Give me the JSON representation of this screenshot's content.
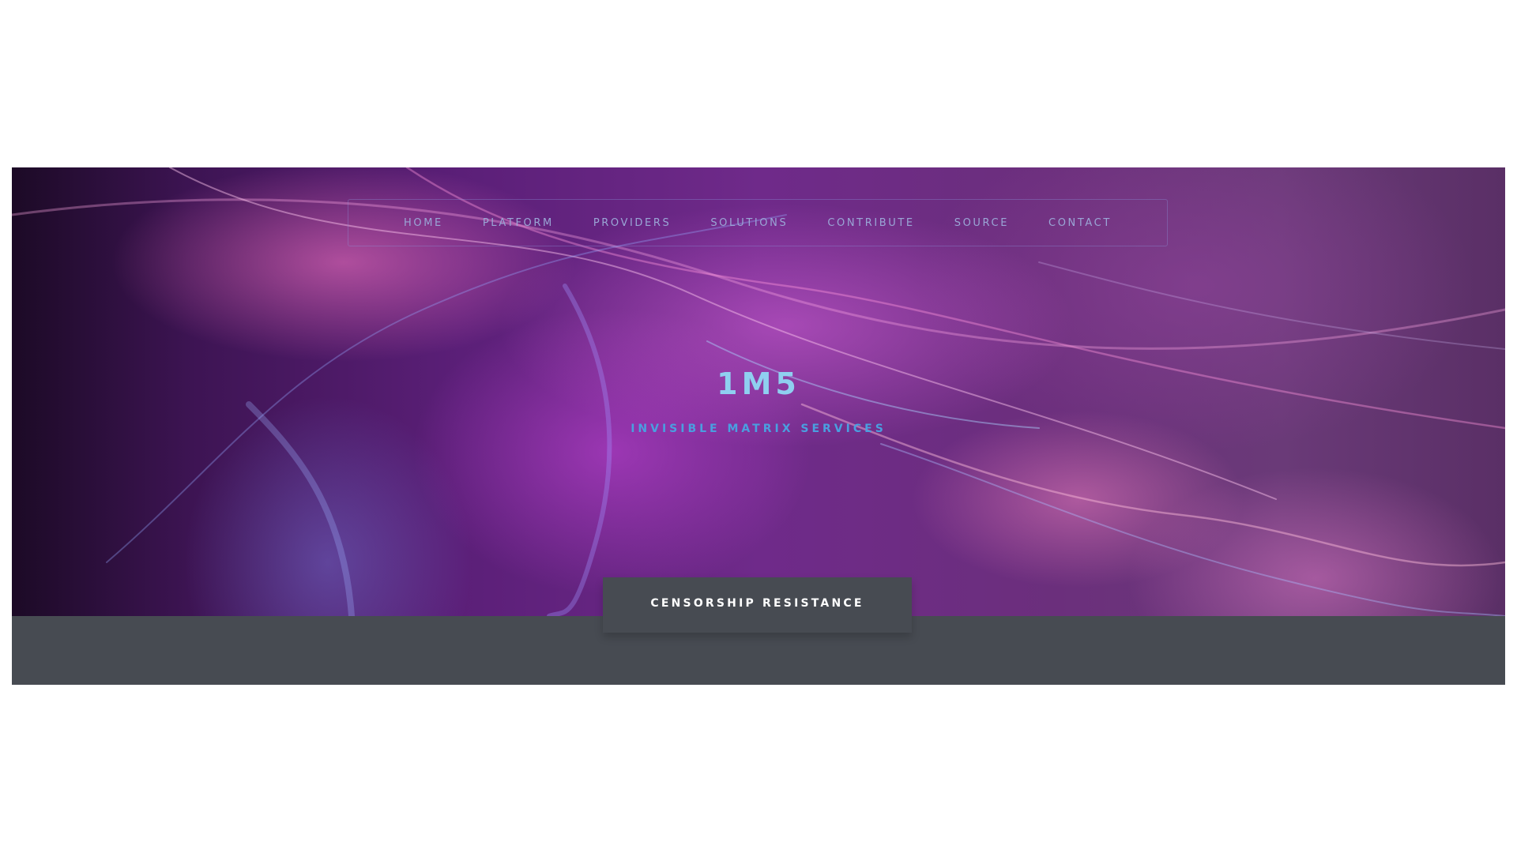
{
  "nav": {
    "items": [
      {
        "label": "HOME"
      },
      {
        "label": "PLATFORM"
      },
      {
        "label": "PROVIDERS"
      },
      {
        "label": "SOLUTIONS"
      },
      {
        "label": "CONTRIBUTE"
      },
      {
        "label": "SOURCE"
      },
      {
        "label": "CONTACT"
      }
    ]
  },
  "hero": {
    "title": "1M5",
    "subtitle": "INVISIBLE MATRIX SERVICES"
  },
  "section_tab": {
    "label": "CENSORSHIP RESISTANCE"
  },
  "colors": {
    "title": "#8fcff0",
    "subtitle": "#4a9fe0",
    "nav_text": "#9aa6d6",
    "footer_band": "#474b52",
    "page_background": "#ffffff"
  }
}
